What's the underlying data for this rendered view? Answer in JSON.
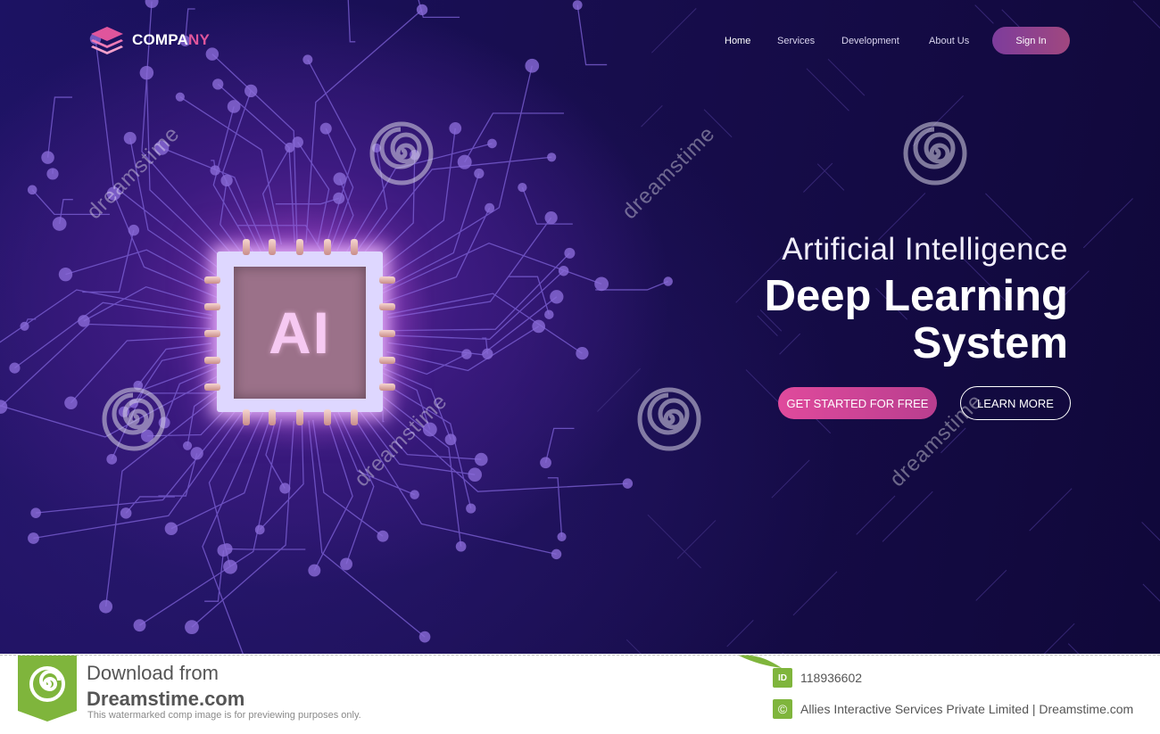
{
  "header": {
    "logo_text_main": "COMPA",
    "logo_text_accent": "NY",
    "nav": [
      {
        "label": "Home"
      },
      {
        "label": "Services"
      },
      {
        "label": "Development"
      },
      {
        "label": "About Us"
      }
    ],
    "signin_label": "Sign In"
  },
  "hero": {
    "chip_label": "AI",
    "subtitle": "Artificial Intelligence",
    "title_line1": "Deep Learning",
    "title_line2": "System",
    "primary_button": "GET STARTED FOR FREE",
    "secondary_button": "LEARN MORE"
  },
  "watermark": {
    "text": "dreamstime"
  },
  "footer": {
    "download_line1": "Download from",
    "download_line2": "Dreamstime.com",
    "note": "This watermarked comp image is for previewing purposes only.",
    "id_badge": "ID",
    "image_id": "118936602",
    "copyright_symbol": "©",
    "credit": "Allies Interactive Services Private Limited | Dreamstime.com"
  },
  "colors": {
    "accent_pink": "#e04a9c",
    "bg_dark": "#170d4c",
    "footer_green": "#7fb53c"
  }
}
